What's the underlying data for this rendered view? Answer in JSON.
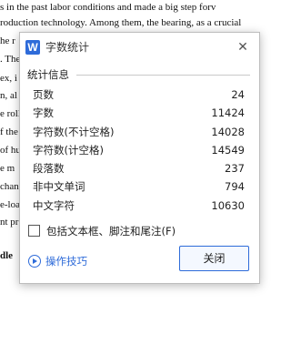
{
  "document": {
    "lines": [
      {
        "text": "s in the past labor conditions and made a big step forv",
        "bold": false
      },
      {
        "text": "roduction technology. Among them, the bearing, as a crucial",
        "bold": false
      },
      {
        "text": "he r",
        "bold": false
      },
      {
        "text": ". Ther",
        "bold": false
      },
      {
        "text": "ex, i",
        "bold": false
      },
      {
        "text": "n, al",
        "bold": false
      },
      {
        "text": "e roll",
        "bold": false
      },
      {
        "text": "f the",
        "bold": false
      },
      {
        "text": "of hu",
        "bold": false
      },
      {
        "text": "e m",
        "bold": false
      },
      {
        "text": "chan",
        "bold": false
      },
      {
        "text": "e-loa",
        "bold": false
      },
      {
        "text": "nt pr",
        "bold": false
      },
      {
        "text": "dle",
        "bold": true
      }
    ]
  },
  "dialog": {
    "title": "字数统计",
    "app_icon_text": "W",
    "close_glyph": "✕",
    "section_title": "统计信息",
    "stats": [
      {
        "label": "页数",
        "value": "24"
      },
      {
        "label": "字数",
        "value": "11424"
      },
      {
        "label": "字符数(不计空格)",
        "value": "14028"
      },
      {
        "label": "字符数(计空格)",
        "value": "14549"
      },
      {
        "label": "段落数",
        "value": "237"
      },
      {
        "label": "非中文单词",
        "value": "794"
      },
      {
        "label": "中文字符",
        "value": "10630"
      }
    ],
    "include_checkbox_label": "包括文本框、脚注和尾注(F)",
    "include_checked": false,
    "tips_label": "操作技巧",
    "ok_label": "关闭",
    "accent_color": "#2e6bd9"
  }
}
